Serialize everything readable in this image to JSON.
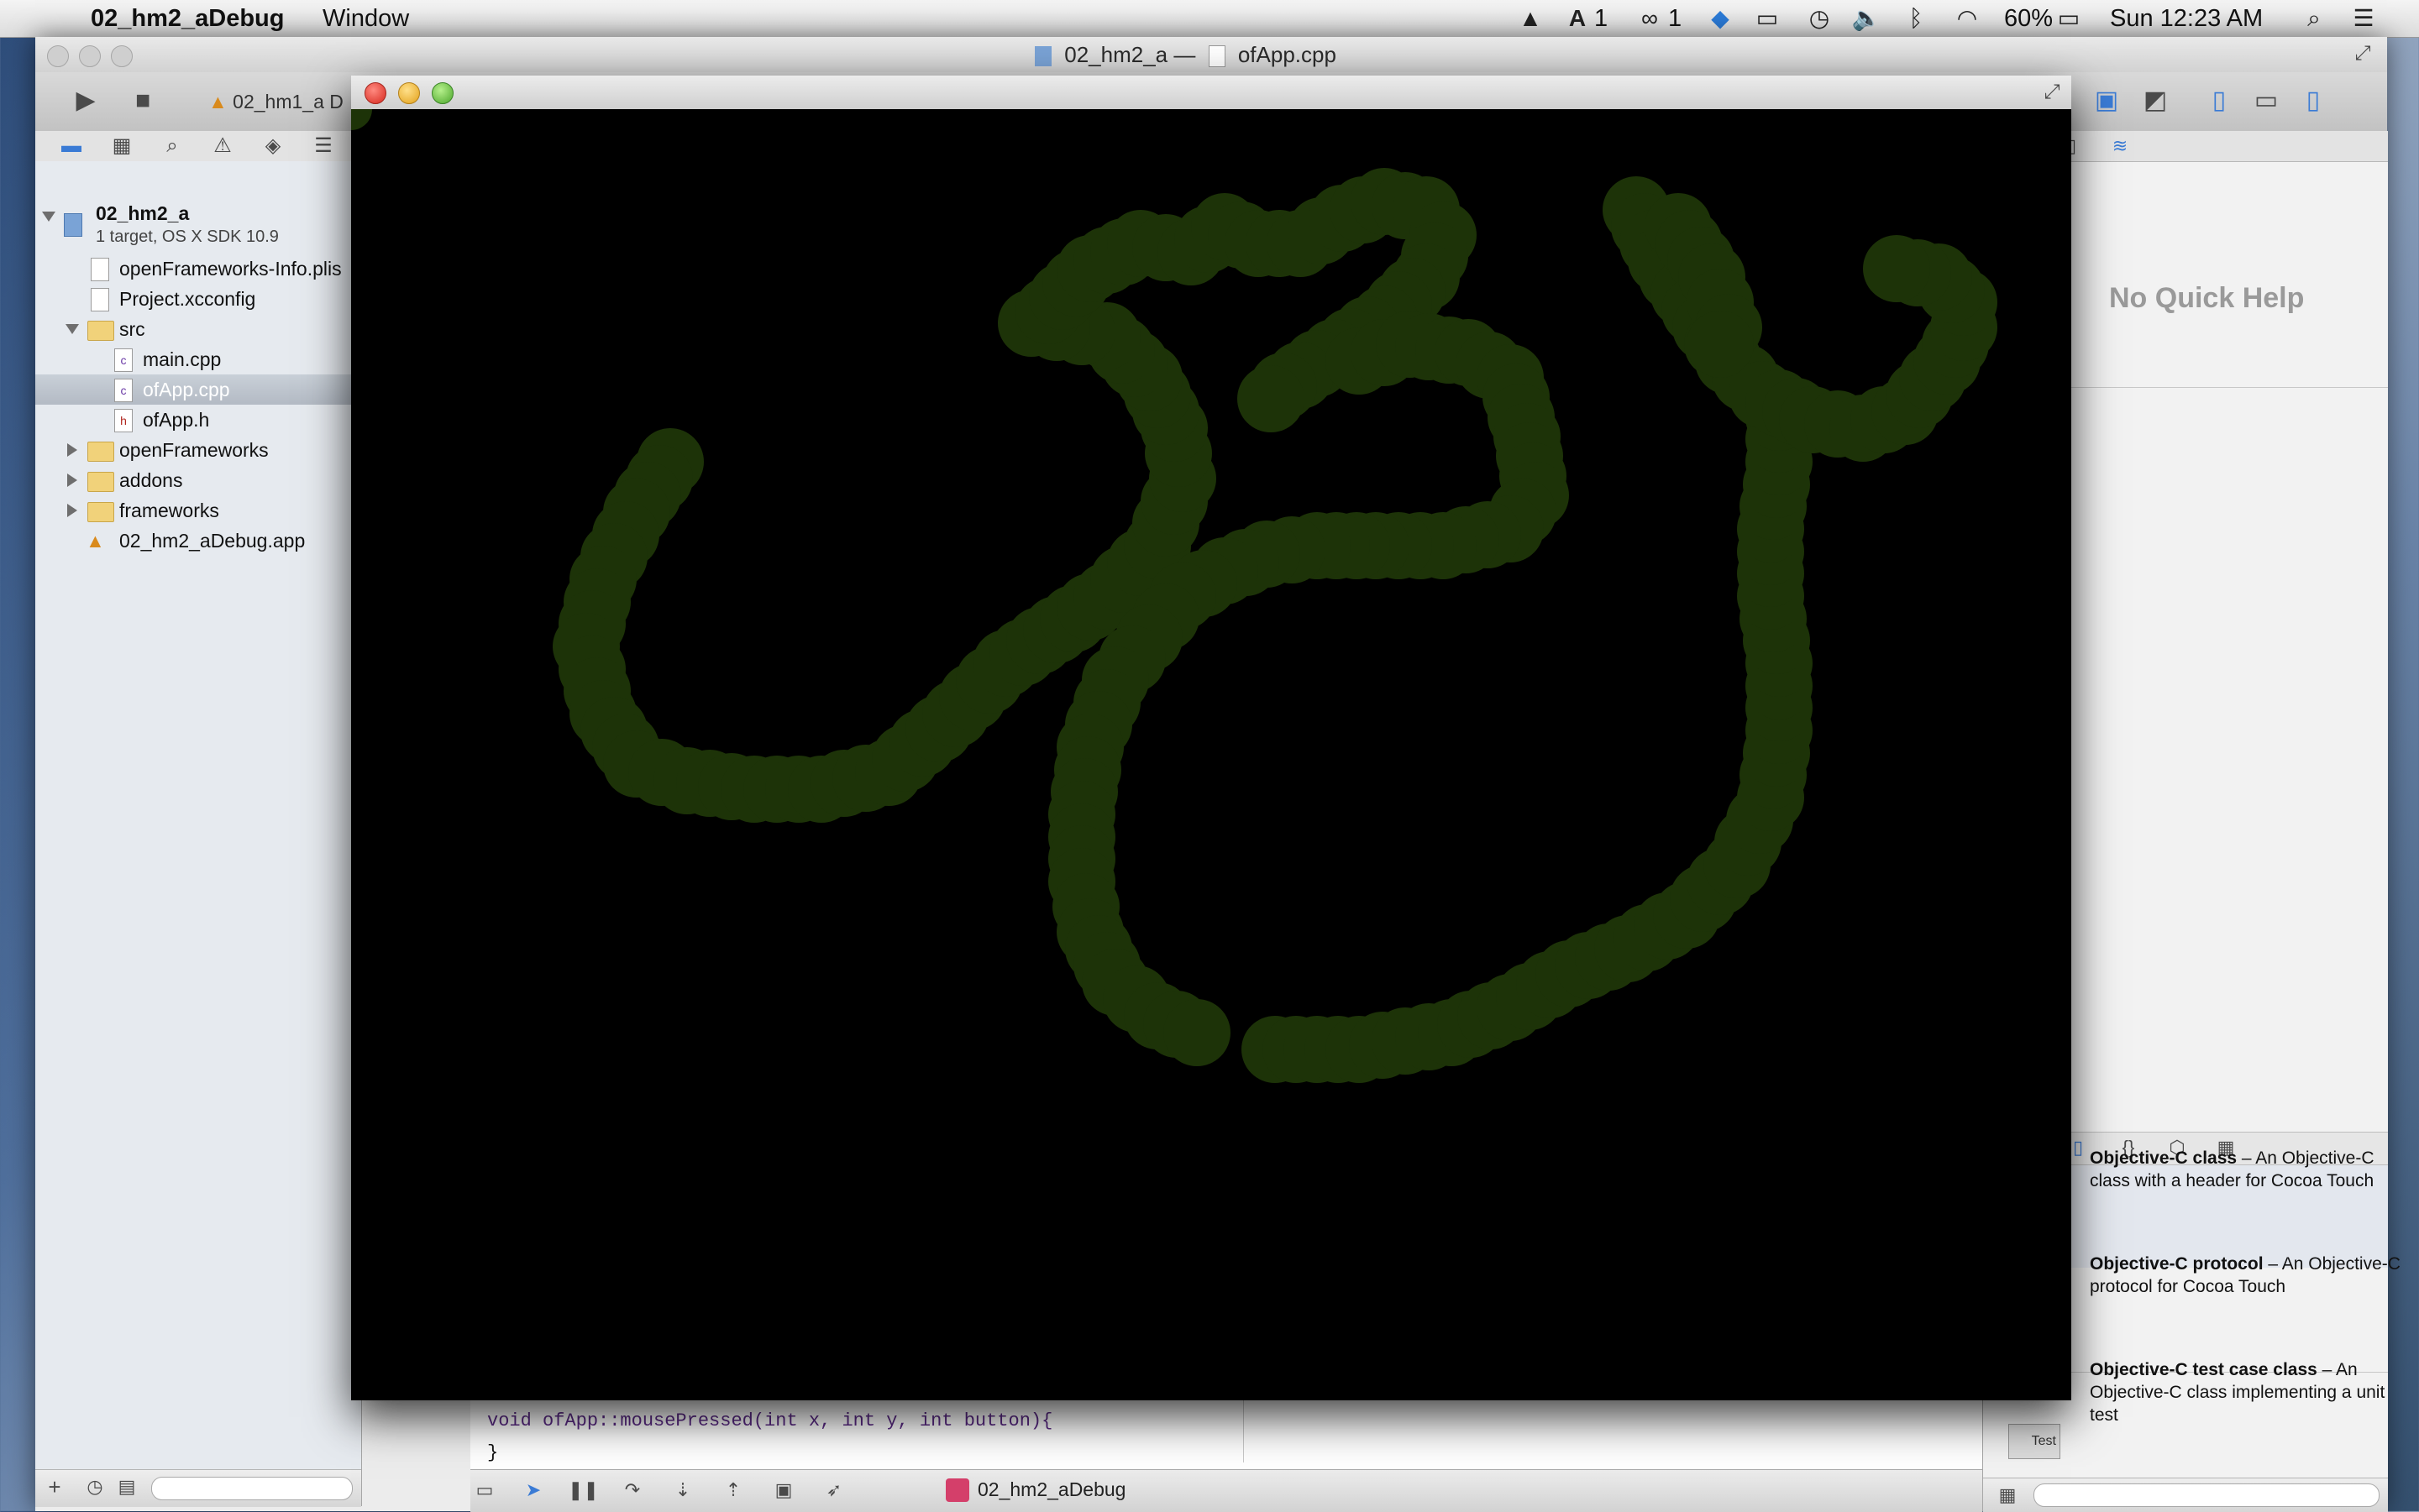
{
  "menubar": {
    "app_name": "02_hm2_aDebug",
    "menu_window": "Window",
    "status_drive_count": "1",
    "status_adobe_count": "1",
    "status_cc_count": "1",
    "battery": "60%",
    "clock": "Sun 12:23 AM",
    "icons": [
      "apple-icon",
      "google-drive-icon",
      "adobe-icon",
      "creative-cloud-icon",
      "dropbox-icon",
      "airplay-icon",
      "time-machine-icon",
      "volume-icon",
      "bluetooth-icon",
      "wifi-icon",
      "battery-icon",
      "spotlight-icon",
      "notification-center-icon"
    ]
  },
  "xcode": {
    "window_title_project": "02_hm2_a",
    "window_title_sep": "—",
    "window_title_file": "ofApp.cpp",
    "scheme_label": "02_hm1_a D",
    "navigator": {
      "project_name": "02_hm2_a",
      "project_sub": "1 target, OS X SDK 10.9",
      "items": [
        {
          "label": "openFrameworks-Info.plis"
        },
        {
          "label": "Project.xcconfig"
        },
        {
          "label": "src"
        },
        {
          "label": "main.cpp"
        },
        {
          "label": "ofApp.cpp"
        },
        {
          "label": "ofApp.h"
        },
        {
          "label": "openFrameworks"
        },
        {
          "label": "addons"
        },
        {
          "label": "frameworks"
        },
        {
          "label": "02_hm2_aDebug.app"
        }
      ]
    },
    "editor_code_line1": "void ofApp::mousePressed(int x, int y, int button){",
    "editor_code_line2": "}",
    "debug_target": "02_hm2_aDebug",
    "quick_help": "No Quick Help",
    "templates": [
      {
        "title": "Objective-C class",
        "desc": " – An Objective-C class with a header for Cocoa Touch"
      },
      {
        "title": "Objective-C protocol",
        "desc": " – An Objective-C protocol for Cocoa Touch"
      },
      {
        "title": "Objective-C test case class",
        "desc": " – An Objective-C class implementing a unit test"
      }
    ],
    "test_badge": "Test"
  },
  "app": {
    "dot_color": "#1d3308",
    "canvas_color": "#000000"
  }
}
